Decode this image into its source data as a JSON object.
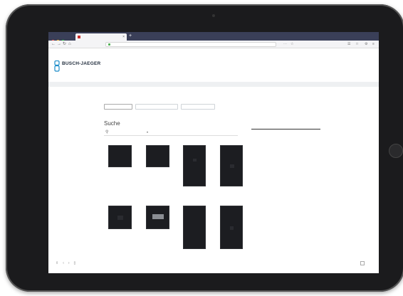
{
  "browser": {
    "tab_title": "",
    "tab_close": "×",
    "new_tab": "+",
    "url": "",
    "nav_icons": [
      "back-icon",
      "forward-icon",
      "reload-icon",
      "home-icon"
    ],
    "window_controls": [
      "#ff5f57",
      "#febc2e",
      "#28c840"
    ]
  },
  "site": {
    "logo_name": "BUSCH-JAEGER",
    "logo_subtitle": "",
    "brand_color": "#1a8bc8",
    "utility_links": [
      ""
    ],
    "header_links": [
      "",
      ""
    ]
  },
  "breadcrumb": {
    "items": [
      "",
      "",
      ""
    ],
    "current": ""
  },
  "main": {
    "tabs": [
      {
        "label": "",
        "active": true
      },
      {
        "label": "",
        "active": false
      },
      {
        "label": "",
        "active": false
      }
    ],
    "search_title": "Suche",
    "search_placeholder": "",
    "search_field_2": "",
    "search_link": "",
    "products": [
      {
        "caption": ""
      },
      {
        "caption": ""
      },
      {
        "caption": ""
      },
      {
        "caption": ""
      },
      {
        "caption": ""
      },
      {
        "caption": ""
      },
      {
        "caption": ""
      },
      {
        "caption": ""
      }
    ]
  },
  "panel": {
    "title": "",
    "title_muted": "",
    "text": ""
  },
  "footer": {
    "left_icons": [
      "share-icon",
      "back-icon",
      "forward-icon",
      "bookmark-icon"
    ],
    "links": [
      "",
      "",
      "",
      "",
      ""
    ]
  }
}
